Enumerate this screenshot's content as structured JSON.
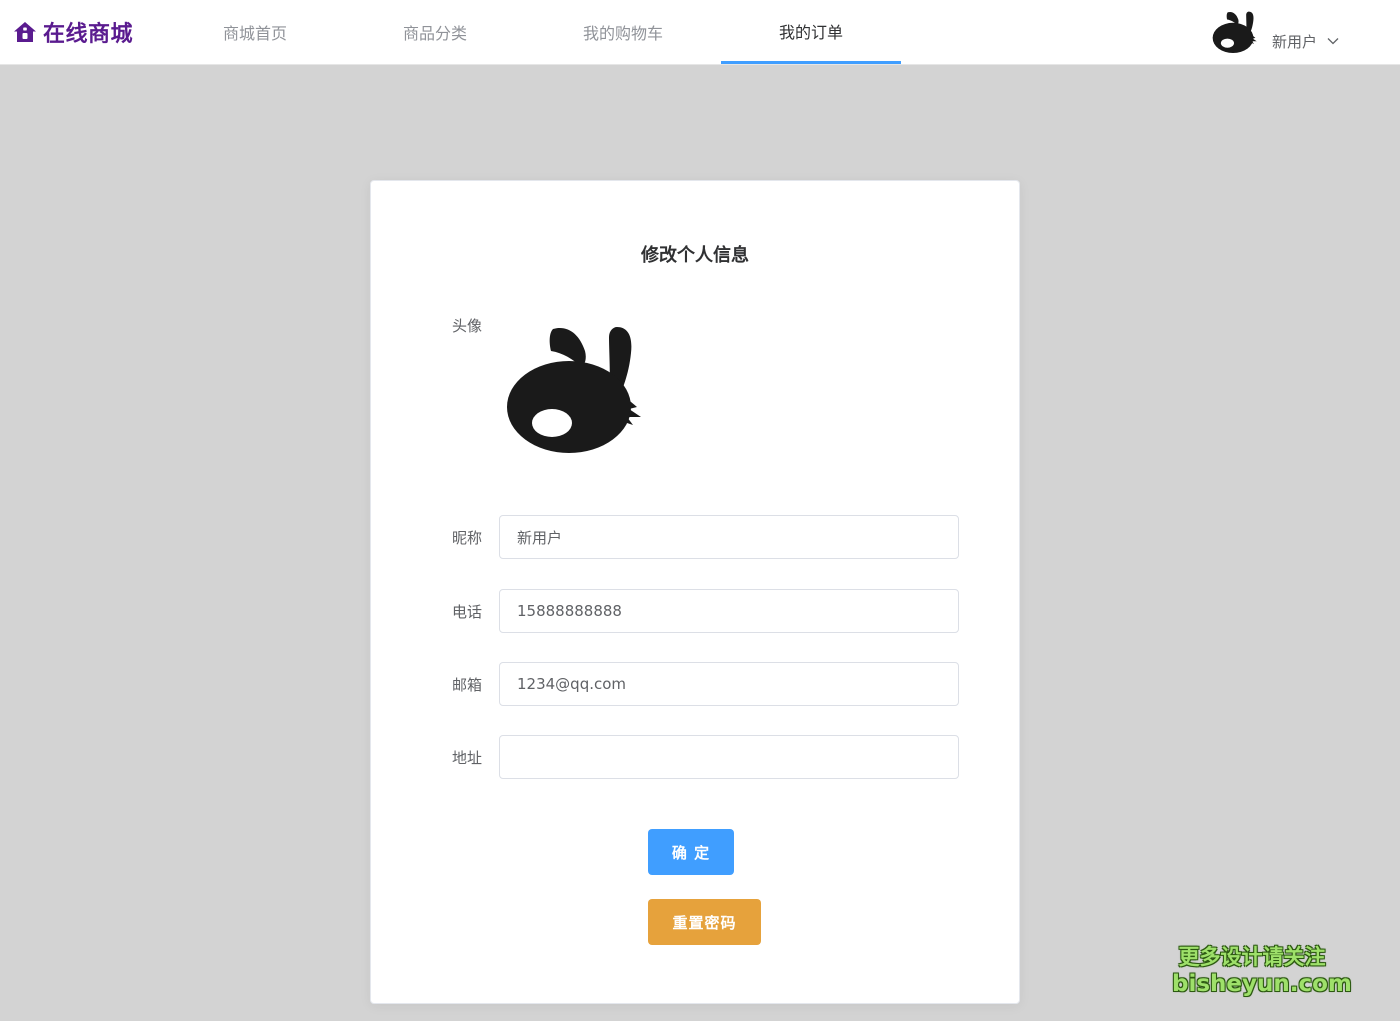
{
  "header": {
    "brand": "在线商城",
    "nav": [
      {
        "label": "商城首页",
        "active": false
      },
      {
        "label": "商品分类",
        "active": false
      },
      {
        "label": "我的购物车",
        "active": false
      },
      {
        "label": "我的订单",
        "active": true
      }
    ],
    "user_name": "新用户"
  },
  "form": {
    "title": "修改个人信息",
    "avatar_label": "头像",
    "nickname_label": "昵称",
    "nickname_value": "新用户",
    "phone_label": "电话",
    "phone_value": "15888888888",
    "email_label": "邮箱",
    "email_value": "1234@qq.com",
    "address_label": "地址",
    "address_value": "",
    "confirm_label": "确 定",
    "reset_label": "重置密码"
  },
  "watermark": {
    "line1": "更多设计请关注",
    "line2": "bisheyun.com"
  },
  "colors": {
    "brand": "#5a1b8f",
    "accent": "#409eff",
    "warning": "#e6a23c",
    "background": "#d3d3d3"
  },
  "icons": {
    "brand": "home-icon",
    "user_avatar": "rabbit-avatar-icon",
    "dropdown": "chevron-down-icon"
  }
}
